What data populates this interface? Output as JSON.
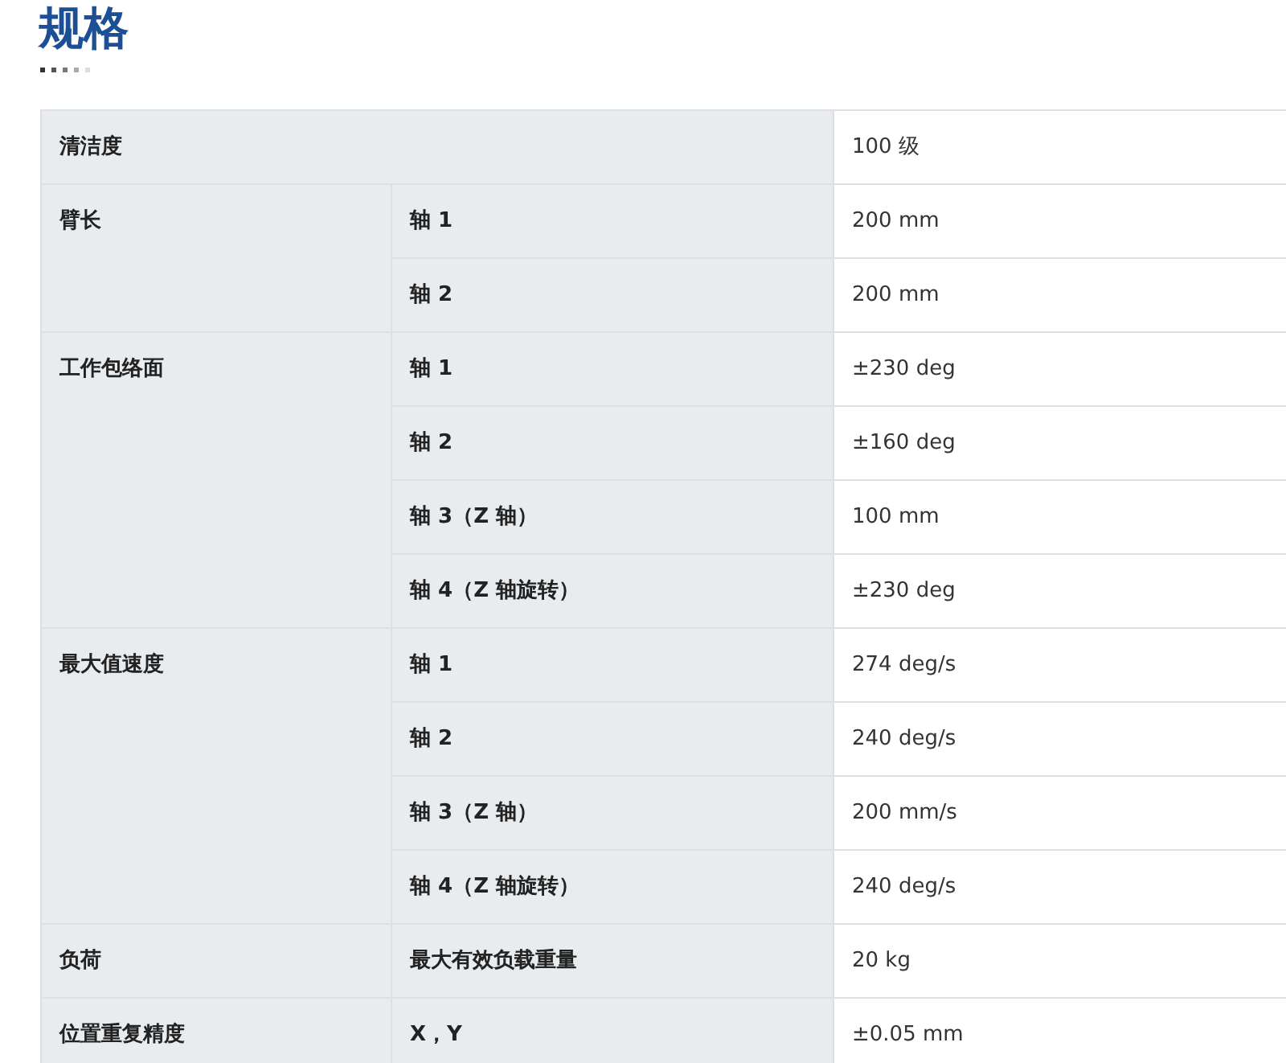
{
  "title": "规格",
  "spec_groups": [
    {
      "label": "清洁度",
      "rows": [
        {
          "value": "100 级"
        }
      ]
    },
    {
      "label": "臂长",
      "rows": [
        {
          "item": "轴 1",
          "value": "200 mm"
        },
        {
          "item": "轴 2",
          "value": "200 mm"
        }
      ]
    },
    {
      "label": "工作包络面",
      "rows": [
        {
          "item": "轴 1",
          "value": "±230 deg"
        },
        {
          "item": "轴 2",
          "value": "±160 deg"
        },
        {
          "item": "轴 3（Z 轴）",
          "value": "100 mm"
        },
        {
          "item": "轴 4（Z 轴旋转）",
          "value": "±230 deg"
        }
      ]
    },
    {
      "label": "最大值速度",
      "rows": [
        {
          "item": "轴 1",
          "value": "274 deg/s"
        },
        {
          "item": "轴 2",
          "value": "240 deg/s"
        },
        {
          "item": "轴 3（Z 轴）",
          "value": "200 mm/s"
        },
        {
          "item": "轴 4（Z 轴旋转）",
          "value": "240 deg/s"
        }
      ]
    },
    {
      "label": "负荷",
      "rows": [
        {
          "item": "最大有效负载重量",
          "value": "20 kg"
        }
      ]
    },
    {
      "label": "位置重复精度",
      "rows": [
        {
          "item": "X，Y",
          "value": "±0.05 mm"
        }
      ]
    }
  ]
}
